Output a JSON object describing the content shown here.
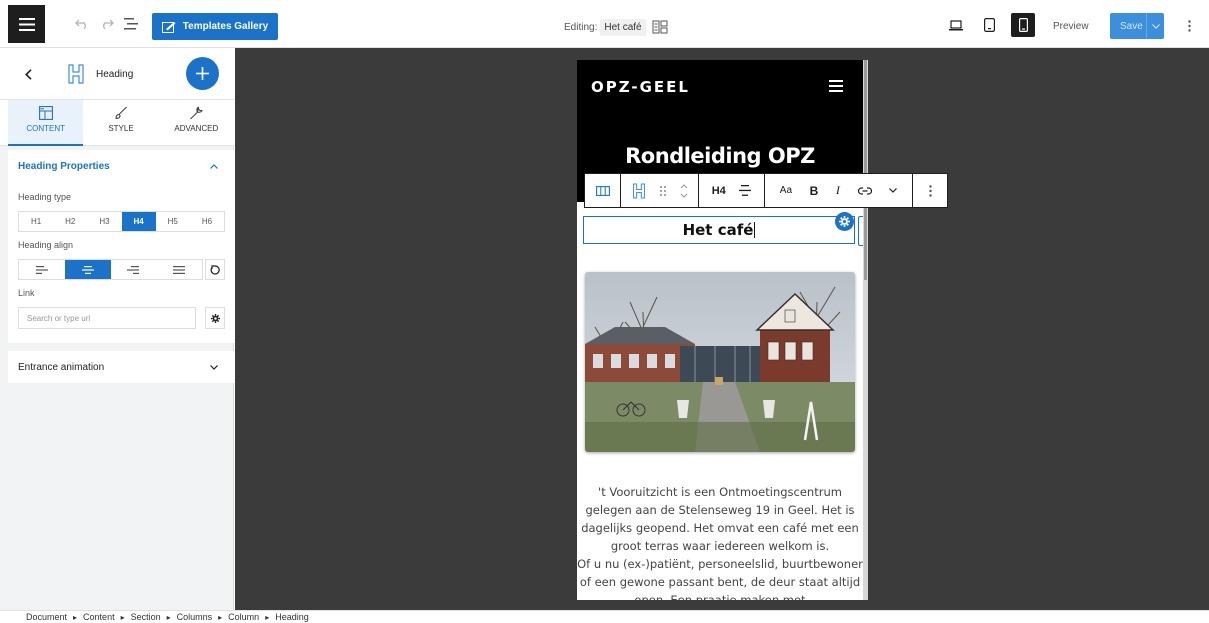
{
  "topbar": {
    "templates_label": "Templates Gallery",
    "editing_label": "Editing:",
    "editing_doc": "Het café",
    "preview_label": "Preview",
    "save_label": "Save"
  },
  "sidebar": {
    "block_name": "Heading",
    "tabs": [
      {
        "label": "CONTENT"
      },
      {
        "label": "STYLE"
      },
      {
        "label": "ADVANCED"
      }
    ],
    "heading_properties": {
      "title": "Heading Properties",
      "heading_type_label": "Heading type",
      "heading_types": [
        "H1",
        "H2",
        "H3",
        "H4",
        "H5",
        "H6"
      ],
      "selected_type": "H4",
      "heading_align_label": "Heading align",
      "selected_align": "center",
      "link_label": "Link",
      "link_placeholder": "Search or type url"
    },
    "entrance_animation_title": "Entrance animation"
  },
  "page": {
    "logo": "OPZ-GEEL",
    "title": "Rondleiding OPZ",
    "heading_text": "Het café",
    "paragraph_1": "'t Vooruitzicht is een Ontmoetingscentrum gelegen aan de Stelenseweg 19 in Geel. Het is dagelijks geopend. Het omvat een café met een groot terras waar iedereen welkom is.",
    "paragraph_2": "Of u nu (ex-)patiënt, personeelslid, buurtbewoner of een gewone passant bent, de deur staat altijd open. Een praatje maken met"
  },
  "toolbar": {
    "level_label": "H4",
    "font_label": "Aa",
    "bold_label": "B",
    "italic_label": "I"
  },
  "breadcrumb": [
    "Document",
    "Content",
    "Section",
    "Columns",
    "Column",
    "Heading"
  ],
  "colors": {
    "accent": "#1a73c8",
    "dark": "#1e1e1e",
    "canvas": "#3b3b3b"
  }
}
